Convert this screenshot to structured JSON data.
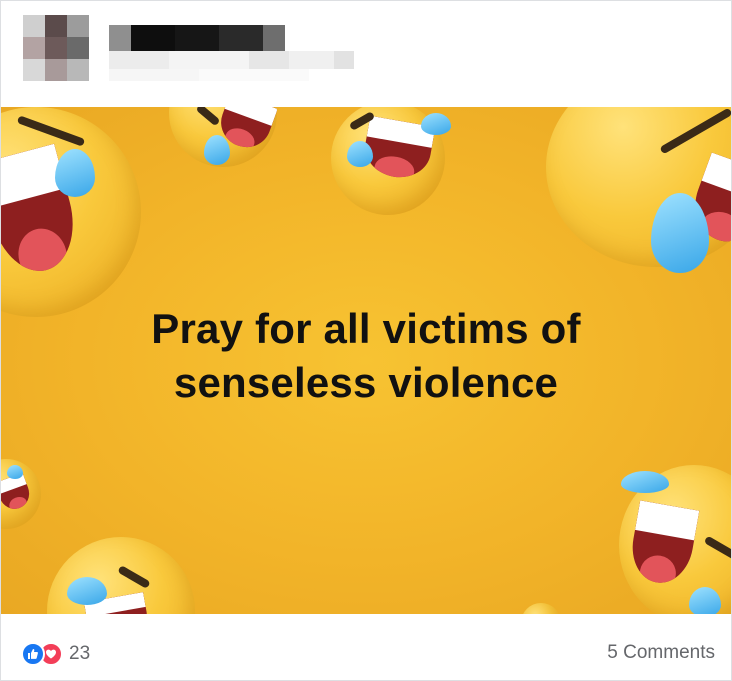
{
  "post": {
    "author_name": "",
    "caption_line1": "Pray for all victims of",
    "caption_line2": "senseless violence",
    "reaction_count": "23",
    "comments_label": "5 Comments"
  },
  "icons": {
    "like": "thumbs-up-icon",
    "love": "heart-icon",
    "emoji": "face-with-tears-of-joy"
  },
  "colors": {
    "background": "#f2b429",
    "caption": "#111111",
    "like": "#1877f2",
    "love": "#f33e58",
    "footer_text": "#65676b"
  }
}
